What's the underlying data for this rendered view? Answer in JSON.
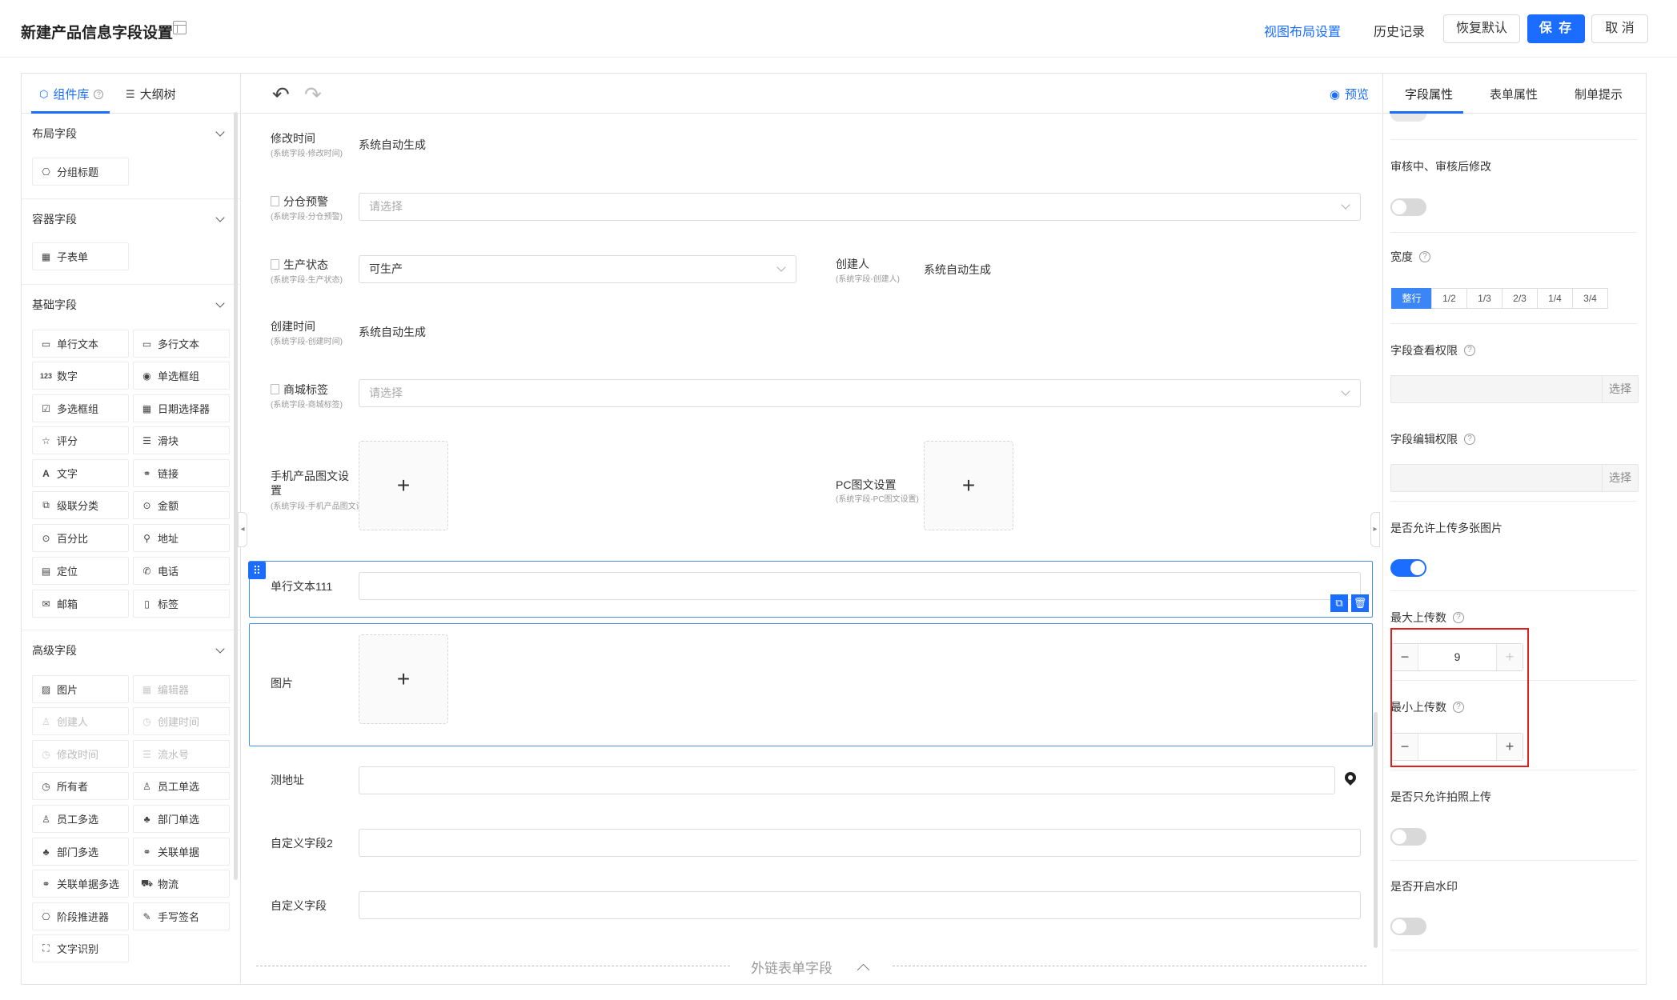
{
  "header": {
    "title": "新建产品信息字段设置",
    "view_layout_link": "视图布局设置",
    "history_link": "历史记录",
    "restore_button": "恢复默认",
    "save_button": "保 存",
    "cancel_button": "取 消"
  },
  "left_panel": {
    "tabs": {
      "library": "组件库",
      "outline": "大纲树"
    },
    "sections": {
      "layout": "布局字段",
      "container": "容器字段",
      "basic": "基础字段",
      "advanced": "高级字段"
    },
    "layout_items": [
      "分组标题"
    ],
    "container_items": [
      "子表单"
    ],
    "basic_items": [
      "单行文本",
      "多行文本",
      "数字",
      "单选框组",
      "多选框组",
      "日期选择器",
      "评分",
      "滑块",
      "文字",
      "链接",
      "级联分类",
      "金额",
      "百分比",
      "地址",
      "定位",
      "电话",
      "邮箱",
      "标签"
    ],
    "advanced_items": [
      "图片",
      "编辑器",
      "创建人",
      "创建时间",
      "修改时间",
      "流水号",
      "所有者",
      "员工单选",
      "员工多选",
      "部门单选",
      "部门多选",
      "关联单据",
      "关联单据多选",
      "物流",
      "阶段推进器",
      "手写签名",
      "文字识别"
    ]
  },
  "canvas": {
    "preview": "预览",
    "fields": {
      "modified_time": {
        "label": "修改时间",
        "sub": "(系统字段-修改时间)",
        "value": "系统自动生成"
      },
      "warehouse_alert": {
        "label": "分仓预警",
        "sub": "(系统字段-分仓预警)",
        "placeholder": "请选择"
      },
      "production_status": {
        "label": "生产状态",
        "sub": "(系统字段-生产状态)",
        "value": "可生产"
      },
      "creator": {
        "label": "创建人",
        "sub": "(系统字段-创建人)",
        "value": "系统自动生成"
      },
      "created_time": {
        "label": "创建时间",
        "sub": "(系统字段-创建时间)",
        "value": "系统自动生成"
      },
      "mall_tag": {
        "label": "商城标签",
        "sub": "(系统字段-商城标签)",
        "placeholder": "请选择"
      },
      "mobile_graphic": {
        "label": "手机产品图文设置",
        "sub": "(系统字段-手机产品图文设置)"
      },
      "pc_graphic": {
        "label": "PC图文设置",
        "sub": "(系统字段-PC图文设置)"
      },
      "single_text_111": {
        "label": "单行文本111"
      },
      "image": {
        "label": "图片"
      },
      "test_address": {
        "label": "测地址"
      },
      "custom_field_2": {
        "label": "自定义字段2"
      },
      "custom_field": {
        "label": "自定义字段"
      }
    },
    "external_divider": "外链表单字段"
  },
  "right_panel": {
    "tabs": {
      "field_props": "字段属性",
      "form_props": "表单属性",
      "hint": "制单提示"
    },
    "review_edit": {
      "label": "审核中、审核后修改",
      "on": false
    },
    "width": {
      "label": "宽度",
      "options": [
        "整行",
        "1/2",
        "1/3",
        "2/3",
        "1/4",
        "3/4"
      ],
      "selected": "整行"
    },
    "view_permission": {
      "label": "字段查看权限",
      "button": "选择"
    },
    "edit_permission": {
      "label": "字段编辑权限",
      "button": "选择"
    },
    "multi_upload": {
      "label": "是否允许上传多张图片",
      "on": true
    },
    "max_upload": {
      "label": "最大上传数",
      "value": "9"
    },
    "min_upload": {
      "label": "最小上传数",
      "value": ""
    },
    "photo_only": {
      "label": "是否只允许拍照上传",
      "on": false
    },
    "watermark": {
      "label": "是否开启水印",
      "on": false
    }
  },
  "colors": {
    "accent": "#1a6dff",
    "highlight": "#e02020"
  }
}
